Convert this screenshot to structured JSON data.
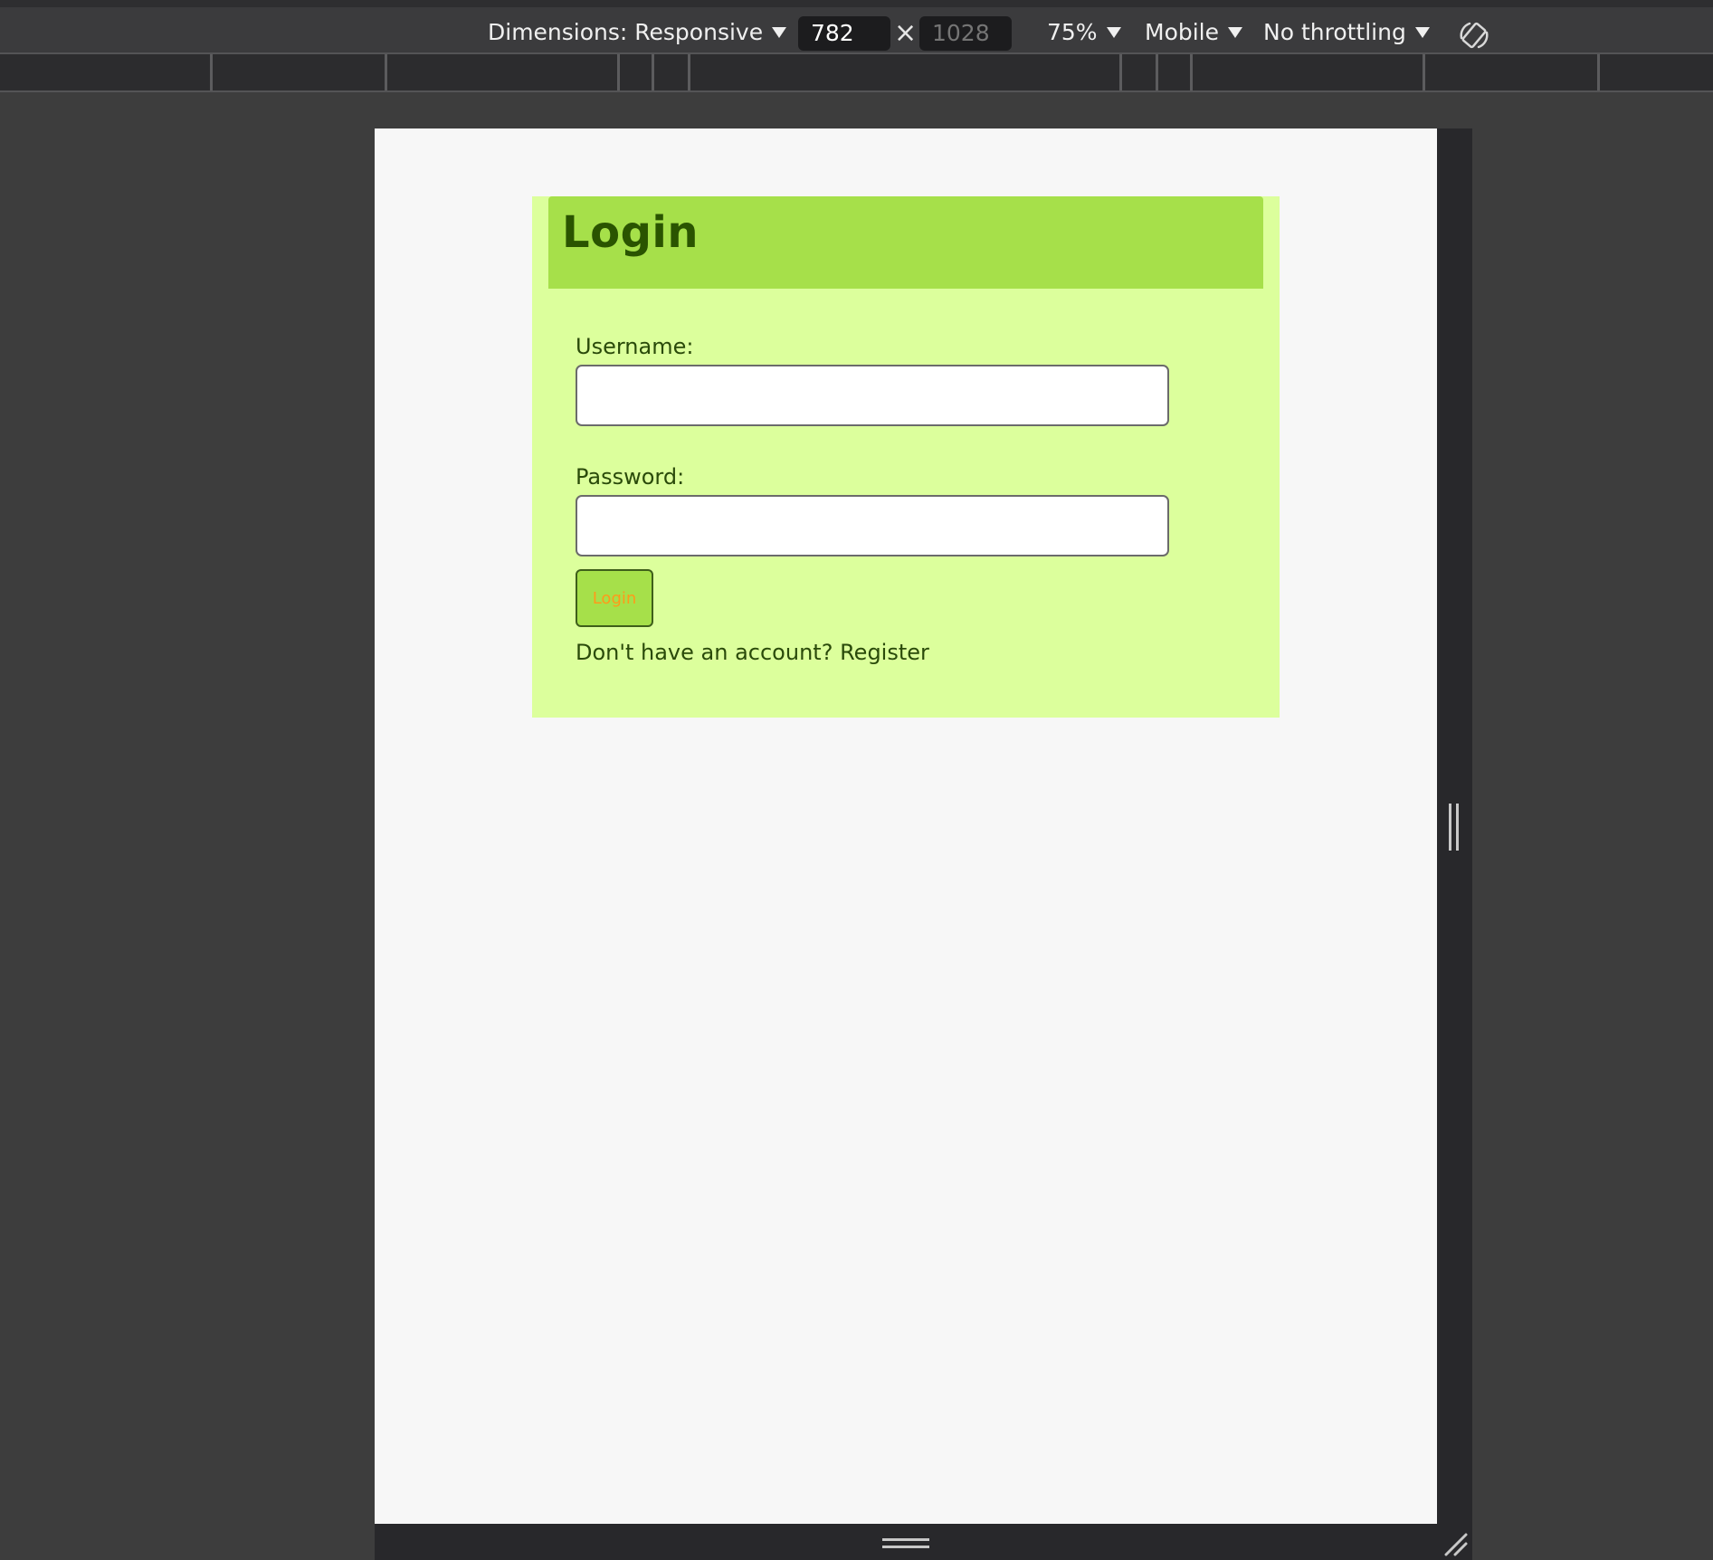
{
  "devtools": {
    "dimensions_label": "Dimensions: Responsive",
    "width_value": "782",
    "times_symbol": "×",
    "height_placeholder": "1028",
    "zoom_label": "75%",
    "device_type_label": "Mobile",
    "throttling_label": "No throttling",
    "rotate_icon": "rotate-device-icon"
  },
  "page": {
    "title": "Login",
    "username_label": "Username:",
    "username_value": "",
    "password_label": "Password:",
    "password_value": "",
    "login_button_label": "Login",
    "register_prompt": "Don't have an account?",
    "register_link": "Register"
  },
  "colors": {
    "card_background": "#dcff9c",
    "header_background": "#a6e04a",
    "title_text": "#2a5400",
    "button_text": "#ff9a1a",
    "page_background": "#f7f7f7",
    "devtools_background": "#3b3b3d"
  }
}
